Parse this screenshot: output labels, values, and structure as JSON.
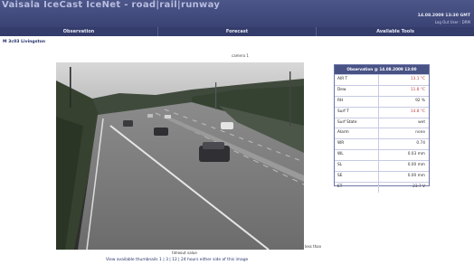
{
  "header": {
    "title": "Vaisala IceCast IceNet - road|rail|runway",
    "date": "14.08.2009 13:30 GMT",
    "user": "Log Out User : DRM"
  },
  "nav": {
    "items": [
      "Observation",
      "Forecast",
      "Available Tools"
    ]
  },
  "site": {
    "name": "M 3c03 Livingston"
  },
  "camera": {
    "label": "camera 1",
    "timeout_text": "timeout value",
    "less_than": "less than"
  },
  "observation": {
    "title": "Observation @ 14.08.2009 13:00",
    "rows": [
      {
        "label": "AIR T",
        "value": "13.1 °C"
      },
      {
        "label": "Dew",
        "value": "11.8 °C"
      },
      {
        "label": "RH",
        "value": "92 %"
      },
      {
        "label": "Surf T",
        "value": "14.8 °C"
      },
      {
        "label": "Surf State",
        "value": "wet"
      },
      {
        "label": "Alarm",
        "value": "none"
      },
      {
        "label": "WR",
        "value": "0.74"
      },
      {
        "label": "WL",
        "value": "0.03 mm"
      },
      {
        "label": "SL",
        "value": "0.00 mm"
      },
      {
        "label": "SE",
        "value": "0.00 mm"
      },
      {
        "label": "ET",
        "value": "23.7 V"
      }
    ]
  },
  "thumbnails": {
    "prefix": "View available thumbnails",
    "links": [
      "1",
      "3",
      "12",
      "24"
    ],
    "suffix": "hours either side of this image"
  },
  "colors": {
    "header": "#4c5688",
    "navbar": "#333c6a",
    "panel_title": "#485285",
    "warm_value": "#c04040"
  }
}
